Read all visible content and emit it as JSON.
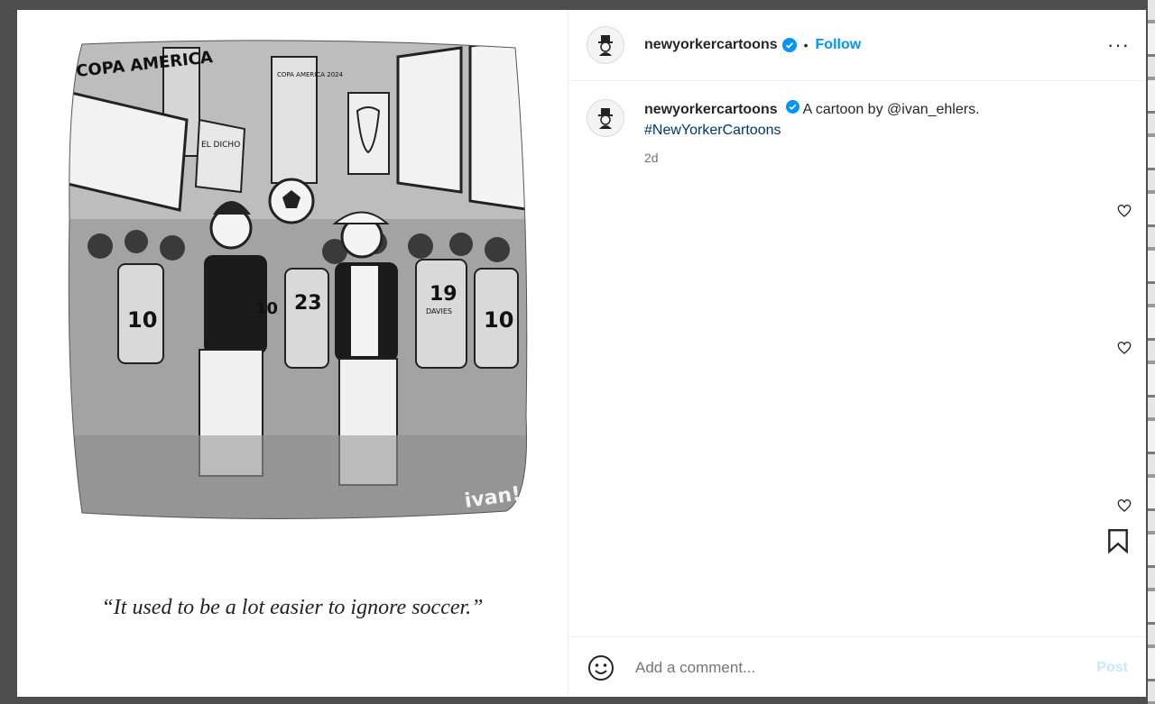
{
  "post": {
    "caption": "“It used to be a lot easier to ignore soccer.”",
    "signature": "ivan!"
  },
  "cartoon_text": {
    "banner": "COPA AMERICA",
    "sign1": "EL DICHO",
    "sign2": "COPA AMERICA 2024",
    "jersey1": "19",
    "jersey1_name": "DAVIES",
    "jersey2": "23",
    "jersey3": "10",
    "jersey4": "10",
    "jersey5": "10"
  },
  "header": {
    "username": "newyorkercartoons",
    "separator": "•",
    "follow_label": "Follow",
    "more_label": "···"
  },
  "comment": {
    "username": "newyorkercartoons",
    "text": "A cartoon by @ivan_ehlers.",
    "hashtag": "#NewYorkerCartoons",
    "time": "2d"
  },
  "comment_bar": {
    "placeholder": "Add a comment...",
    "post_label": "Post"
  },
  "colors": {
    "accent": "#0095f6",
    "hashtag": "#00376b",
    "muted": "#737373",
    "post_disabled": "#c9e7fd"
  }
}
